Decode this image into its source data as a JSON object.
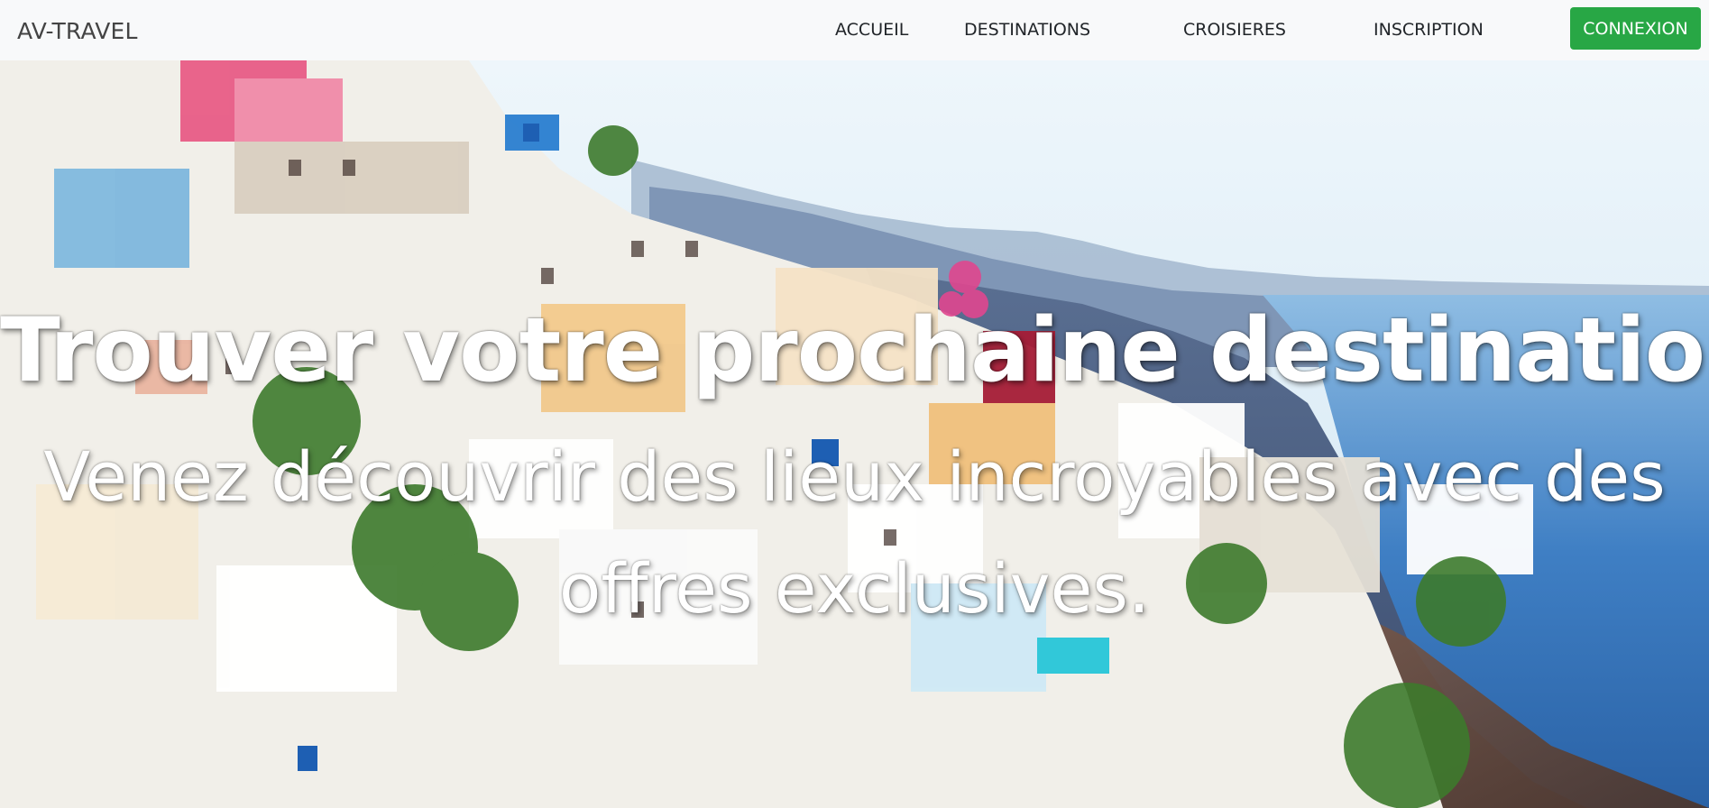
{
  "navbar": {
    "brand": "AV-TRAVEL",
    "links": [
      {
        "label": "ACCUEIL"
      },
      {
        "label": "DESTINATIONS"
      },
      {
        "label": "CROISIERES"
      },
      {
        "label": "INSCRIPTION"
      }
    ],
    "login_button": "CONNEXION"
  },
  "hero": {
    "title": "Trouver votre prochaine destination.",
    "subtitle": "Venez découvrir des lieux incroyables avec des offres exclusives."
  },
  "colors": {
    "navbar_bg": "#f8f9fa",
    "button_green": "#28a745",
    "sea_blue": "#3f7fc4"
  }
}
